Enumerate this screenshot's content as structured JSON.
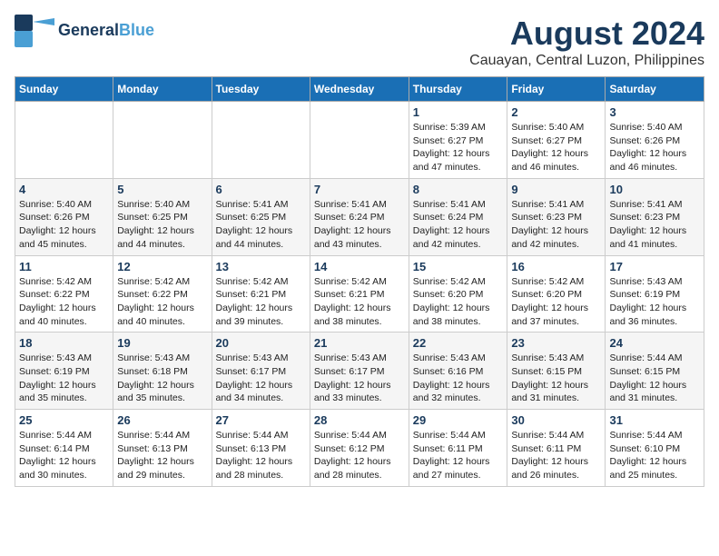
{
  "logo": {
    "text1": "General",
    "text2": "Blue"
  },
  "title": "August 2024",
  "subtitle": "Cauayan, Central Luzon, Philippines",
  "weekdays": [
    "Sunday",
    "Monday",
    "Tuesday",
    "Wednesday",
    "Thursday",
    "Friday",
    "Saturday"
  ],
  "weeks": [
    [
      {
        "day": "",
        "content": ""
      },
      {
        "day": "",
        "content": ""
      },
      {
        "day": "",
        "content": ""
      },
      {
        "day": "",
        "content": ""
      },
      {
        "day": "1",
        "content": "Sunrise: 5:39 AM\nSunset: 6:27 PM\nDaylight: 12 hours\nand 47 minutes."
      },
      {
        "day": "2",
        "content": "Sunrise: 5:40 AM\nSunset: 6:27 PM\nDaylight: 12 hours\nand 46 minutes."
      },
      {
        "day": "3",
        "content": "Sunrise: 5:40 AM\nSunset: 6:26 PM\nDaylight: 12 hours\nand 46 minutes."
      }
    ],
    [
      {
        "day": "4",
        "content": "Sunrise: 5:40 AM\nSunset: 6:26 PM\nDaylight: 12 hours\nand 45 minutes."
      },
      {
        "day": "5",
        "content": "Sunrise: 5:40 AM\nSunset: 6:25 PM\nDaylight: 12 hours\nand 44 minutes."
      },
      {
        "day": "6",
        "content": "Sunrise: 5:41 AM\nSunset: 6:25 PM\nDaylight: 12 hours\nand 44 minutes."
      },
      {
        "day": "7",
        "content": "Sunrise: 5:41 AM\nSunset: 6:24 PM\nDaylight: 12 hours\nand 43 minutes."
      },
      {
        "day": "8",
        "content": "Sunrise: 5:41 AM\nSunset: 6:24 PM\nDaylight: 12 hours\nand 42 minutes."
      },
      {
        "day": "9",
        "content": "Sunrise: 5:41 AM\nSunset: 6:23 PM\nDaylight: 12 hours\nand 42 minutes."
      },
      {
        "day": "10",
        "content": "Sunrise: 5:41 AM\nSunset: 6:23 PM\nDaylight: 12 hours\nand 41 minutes."
      }
    ],
    [
      {
        "day": "11",
        "content": "Sunrise: 5:42 AM\nSunset: 6:22 PM\nDaylight: 12 hours\nand 40 minutes."
      },
      {
        "day": "12",
        "content": "Sunrise: 5:42 AM\nSunset: 6:22 PM\nDaylight: 12 hours\nand 40 minutes."
      },
      {
        "day": "13",
        "content": "Sunrise: 5:42 AM\nSunset: 6:21 PM\nDaylight: 12 hours\nand 39 minutes."
      },
      {
        "day": "14",
        "content": "Sunrise: 5:42 AM\nSunset: 6:21 PM\nDaylight: 12 hours\nand 38 minutes."
      },
      {
        "day": "15",
        "content": "Sunrise: 5:42 AM\nSunset: 6:20 PM\nDaylight: 12 hours\nand 38 minutes."
      },
      {
        "day": "16",
        "content": "Sunrise: 5:42 AM\nSunset: 6:20 PM\nDaylight: 12 hours\nand 37 minutes."
      },
      {
        "day": "17",
        "content": "Sunrise: 5:43 AM\nSunset: 6:19 PM\nDaylight: 12 hours\nand 36 minutes."
      }
    ],
    [
      {
        "day": "18",
        "content": "Sunrise: 5:43 AM\nSunset: 6:19 PM\nDaylight: 12 hours\nand 35 minutes."
      },
      {
        "day": "19",
        "content": "Sunrise: 5:43 AM\nSunset: 6:18 PM\nDaylight: 12 hours\nand 35 minutes."
      },
      {
        "day": "20",
        "content": "Sunrise: 5:43 AM\nSunset: 6:17 PM\nDaylight: 12 hours\nand 34 minutes."
      },
      {
        "day": "21",
        "content": "Sunrise: 5:43 AM\nSunset: 6:17 PM\nDaylight: 12 hours\nand 33 minutes."
      },
      {
        "day": "22",
        "content": "Sunrise: 5:43 AM\nSunset: 6:16 PM\nDaylight: 12 hours\nand 32 minutes."
      },
      {
        "day": "23",
        "content": "Sunrise: 5:43 AM\nSunset: 6:15 PM\nDaylight: 12 hours\nand 31 minutes."
      },
      {
        "day": "24",
        "content": "Sunrise: 5:44 AM\nSunset: 6:15 PM\nDaylight: 12 hours\nand 31 minutes."
      }
    ],
    [
      {
        "day": "25",
        "content": "Sunrise: 5:44 AM\nSunset: 6:14 PM\nDaylight: 12 hours\nand 30 minutes."
      },
      {
        "day": "26",
        "content": "Sunrise: 5:44 AM\nSunset: 6:13 PM\nDaylight: 12 hours\nand 29 minutes."
      },
      {
        "day": "27",
        "content": "Sunrise: 5:44 AM\nSunset: 6:13 PM\nDaylight: 12 hours\nand 28 minutes."
      },
      {
        "day": "28",
        "content": "Sunrise: 5:44 AM\nSunset: 6:12 PM\nDaylight: 12 hours\nand 28 minutes."
      },
      {
        "day": "29",
        "content": "Sunrise: 5:44 AM\nSunset: 6:11 PM\nDaylight: 12 hours\nand 27 minutes."
      },
      {
        "day": "30",
        "content": "Sunrise: 5:44 AM\nSunset: 6:11 PM\nDaylight: 12 hours\nand 26 minutes."
      },
      {
        "day": "31",
        "content": "Sunrise: 5:44 AM\nSunset: 6:10 PM\nDaylight: 12 hours\nand 25 minutes."
      }
    ]
  ]
}
